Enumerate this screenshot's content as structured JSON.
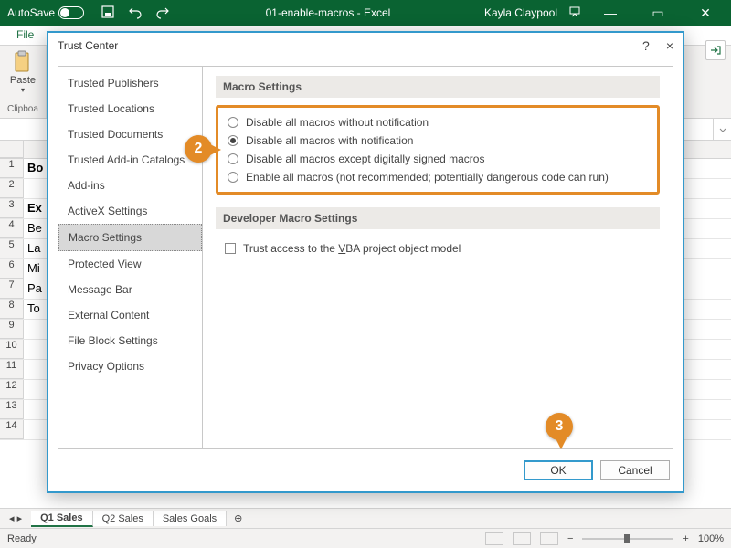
{
  "titlebar": {
    "autosave_label": "AutoSave",
    "autosave_state": "Off",
    "doc_title": "01-enable-macros - Excel",
    "user": "Kayla Claypool"
  },
  "ribbon": {
    "file_tab": "File",
    "paste_label": "Paste",
    "clipboard_group": "Clipboa"
  },
  "sheet": {
    "rows": [
      "Bo",
      "",
      "Ex",
      "Be",
      "La",
      "Mi",
      "Pa",
      "To"
    ],
    "row2_full": "",
    "tabs": [
      "Q1 Sales",
      "Q2 Sales",
      "Sales Goals"
    ],
    "active_tab": 0
  },
  "statusbar": {
    "ready": "Ready",
    "zoom": "100%"
  },
  "dialog": {
    "title": "Trust Center",
    "help": "?",
    "close": "×",
    "sidebar": [
      "Trusted Publishers",
      "Trusted Locations",
      "Trusted Documents",
      "Trusted Add-in Catalogs",
      "Add-ins",
      "ActiveX Settings",
      "Macro Settings",
      "Protected View",
      "Message Bar",
      "External Content",
      "File Block Settings",
      "Privacy Options"
    ],
    "selected_sidebar": 6,
    "section1": "Macro Settings",
    "radios": [
      "Disable all macros without notification",
      "Disable all macros with notification",
      "Disable all macros except digitally signed macros",
      "Enable all macros (not recommended; potentially dangerous code can run)"
    ],
    "radio_underline_chars": [
      "",
      "i",
      "g",
      "E"
    ],
    "selected_radio": 1,
    "section2": "Developer Macro Settings",
    "checkbox_pre": "Trust access to the ",
    "checkbox_u": "V",
    "checkbox_post": "BA project object model",
    "ok": "OK",
    "cancel": "Cancel"
  },
  "callouts": {
    "c2": "2",
    "c3": "3"
  }
}
